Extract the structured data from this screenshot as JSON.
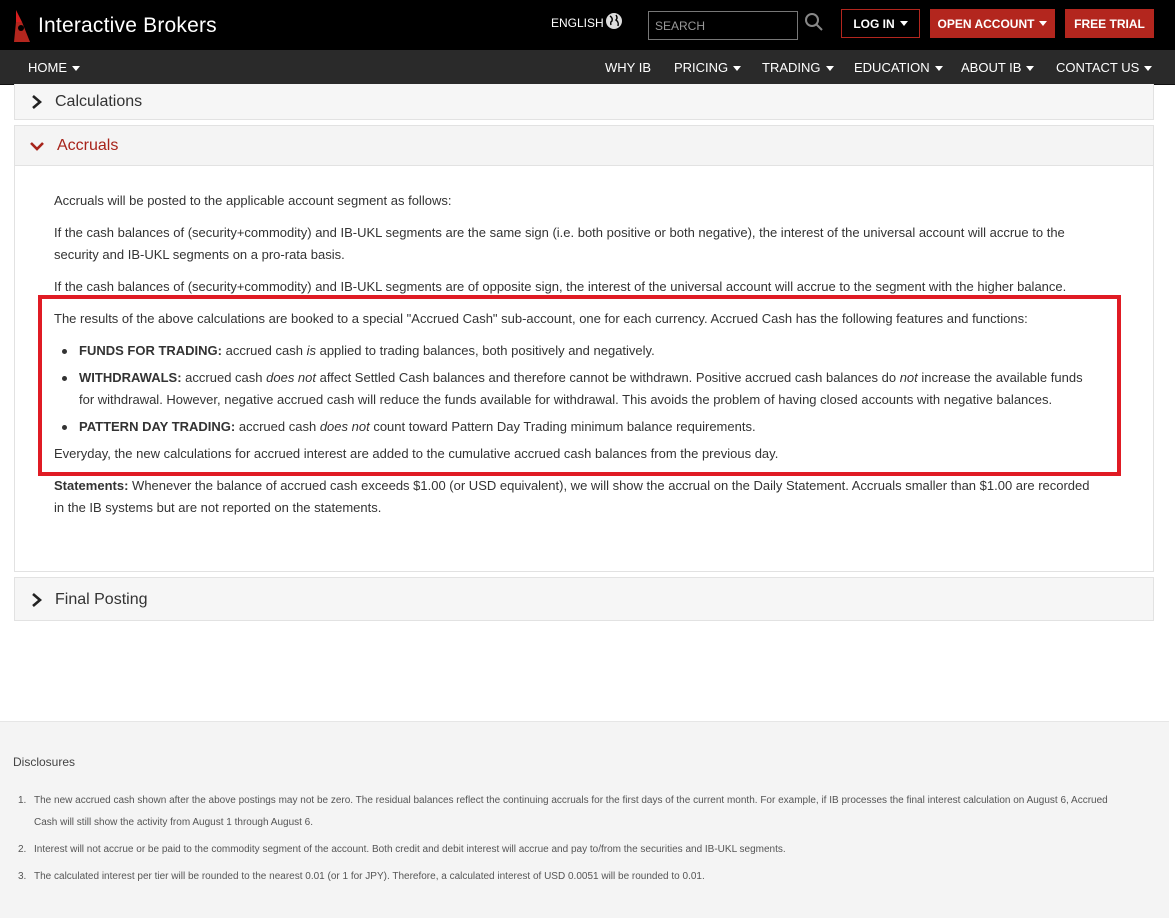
{
  "header": {
    "logo_text": "Interactive Brokers",
    "language": "ENGLISH",
    "search_placeholder": "SEARCH",
    "login_label": "LOG IN",
    "open_account_label": "OPEN ACCOUNT",
    "free_trial_label": "FREE TRIAL",
    "accent_color": "#b3261e"
  },
  "nav": {
    "home": "HOME",
    "items": [
      "WHY IB",
      "PRICING",
      "TRADING",
      "EDUCATION",
      "ABOUT IB",
      "CONTACT US"
    ]
  },
  "sections": {
    "calculations_title": "Calculations",
    "accruals_title": "Accruals",
    "final_posting_title": "Final Posting"
  },
  "accruals": {
    "p1": "Accruals will be posted to the applicable account segment as follows:",
    "p2": "If the cash balances of (security+commodity) and IB-UKL segments are the same sign (i.e. both positive or both negative), the interest of the universal account will accrue to the security and IB-UKL segments on a pro-rata basis.",
    "p3": "If the cash balances of (security+commodity) and IB-UKL segments are of opposite sign, the interest of the universal account will accrue to the segment with the higher balance.",
    "p4": "The results of the above calculations are booked to a special \"Accrued Cash\" sub-account, one for each currency. Accrued Cash has the following features and functions:",
    "bullet1_label": "FUNDS FOR TRADING:",
    "bullet1_a": "accrued cash",
    "bullet1_em": "is",
    "bullet1_b": "applied to trading balances, both positively and negatively.",
    "bullet2_label": "WITHDRAWALS:",
    "bullet2_a": "accrued cash",
    "bullet2_em": "does not",
    "bullet2_b": "affect Settled Cash balances and therefore cannot be withdrawn. Positive accrued cash balances do",
    "bullet2_em2": "not",
    "bullet2_c": "increase the available funds for withdrawal. However, negative accrued cash will reduce the funds available for withdrawal. This avoids the problem of having closed accounts with negative balances.",
    "bullet3_label": "PATTERN DAY TRADING:",
    "bullet3_a": "accrued cash",
    "bullet3_em": "does not",
    "bullet3_b": "count toward Pattern Day Trading minimum balance requirements.",
    "p5": "Everyday, the new calculations for accrued interest are added to the cumulative accrued cash balances from the previous day.",
    "statements_label": "Statements:",
    "statements_text": "Whenever the balance of accrued cash exceeds $1.00 (or USD equivalent), we will show the accrual on the Daily Statement. Accruals smaller than $1.00 are recorded in the IB systems but are not reported on the statements."
  },
  "disclosures": {
    "title": "Disclosures",
    "items": [
      {
        "num": "1.",
        "text": "The new accrued cash shown after the above postings may not be zero. The residual balances reflect the continuing accruals for the first days of the current month. For example, if IB processes the final interest calculation on August 6, Accrued Cash will still show the activity from August 1 through August 6."
      },
      {
        "num": "2.",
        "text": "Interest will not accrue or be paid to the commodity segment of the account. Both credit and debit interest will accrue and pay to/from the securities and IB-UKL segments."
      },
      {
        "num": "3.",
        "text": "The calculated interest per tier will be rounded to the nearest 0.01 (or 1 for JPY). Therefore, a calculated interest of USD 0.0051 will be rounded to 0.01."
      }
    ]
  }
}
